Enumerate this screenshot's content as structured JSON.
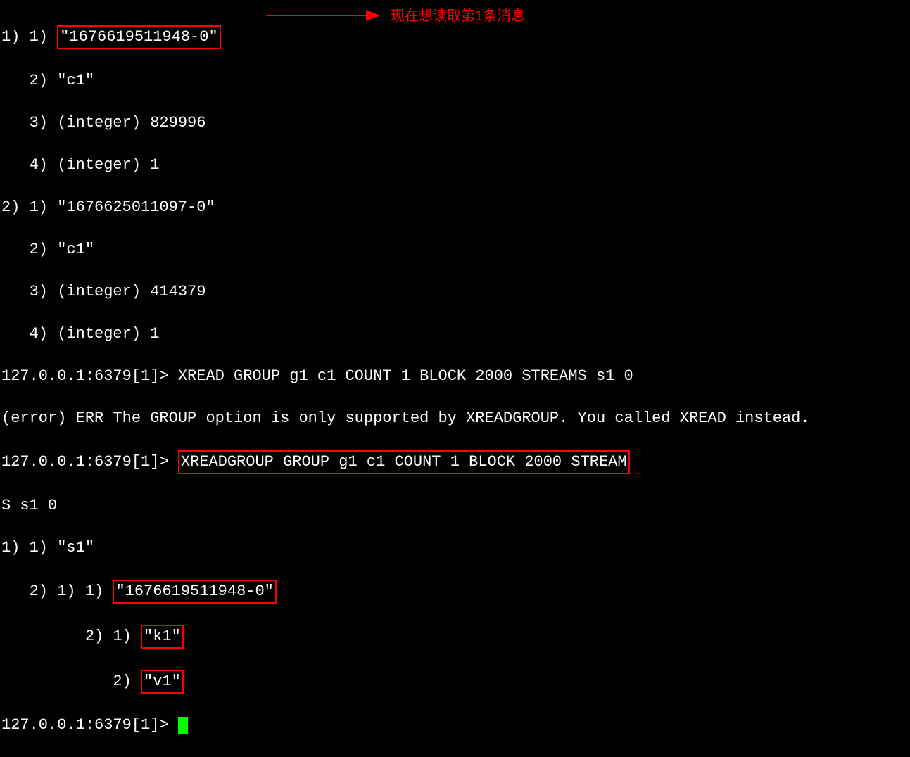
{
  "annotation": "现在想读取第1条消息",
  "lines": {
    "l1_prefix": "1) 1) ",
    "l1_box": "\"1676619511948-0\"",
    "l2": "   2) \"c1\"",
    "l3": "   3) (integer) 829996",
    "l4": "   4) (integer) 1",
    "l5": "2) 1) \"1676625011097-0\"",
    "l6": "   2) \"c1\"",
    "l7": "   3) (integer) 414379",
    "l8": "   4) (integer) 1",
    "l9": "127.0.0.1:6379[1]> XREAD GROUP g1 c1 COUNT 1 BLOCK 2000 STREAMS s1 0",
    "l10": "(error) ERR The GROUP option is only supported by XREADGROUP. You called XREAD instead.",
    "l11_prefix": "127.0.0.1:6379[1]> ",
    "l11_box": "XREADGROUP GROUP g1 c1 COUNT 1 BLOCK 2000 STREAM",
    "l11b": "S s1 0",
    "l12": "1) 1) \"s1\"",
    "l13_prefix": "   2) 1) 1) ",
    "l13_box": "\"1676619511948-0\"",
    "l14_prefix": "         2) 1) ",
    "l14_box": "\"k1\"",
    "l15_prefix": "            2) ",
    "l15_box": "\"v1\"",
    "l16": "127.0.0.1:6379[1]> "
  }
}
